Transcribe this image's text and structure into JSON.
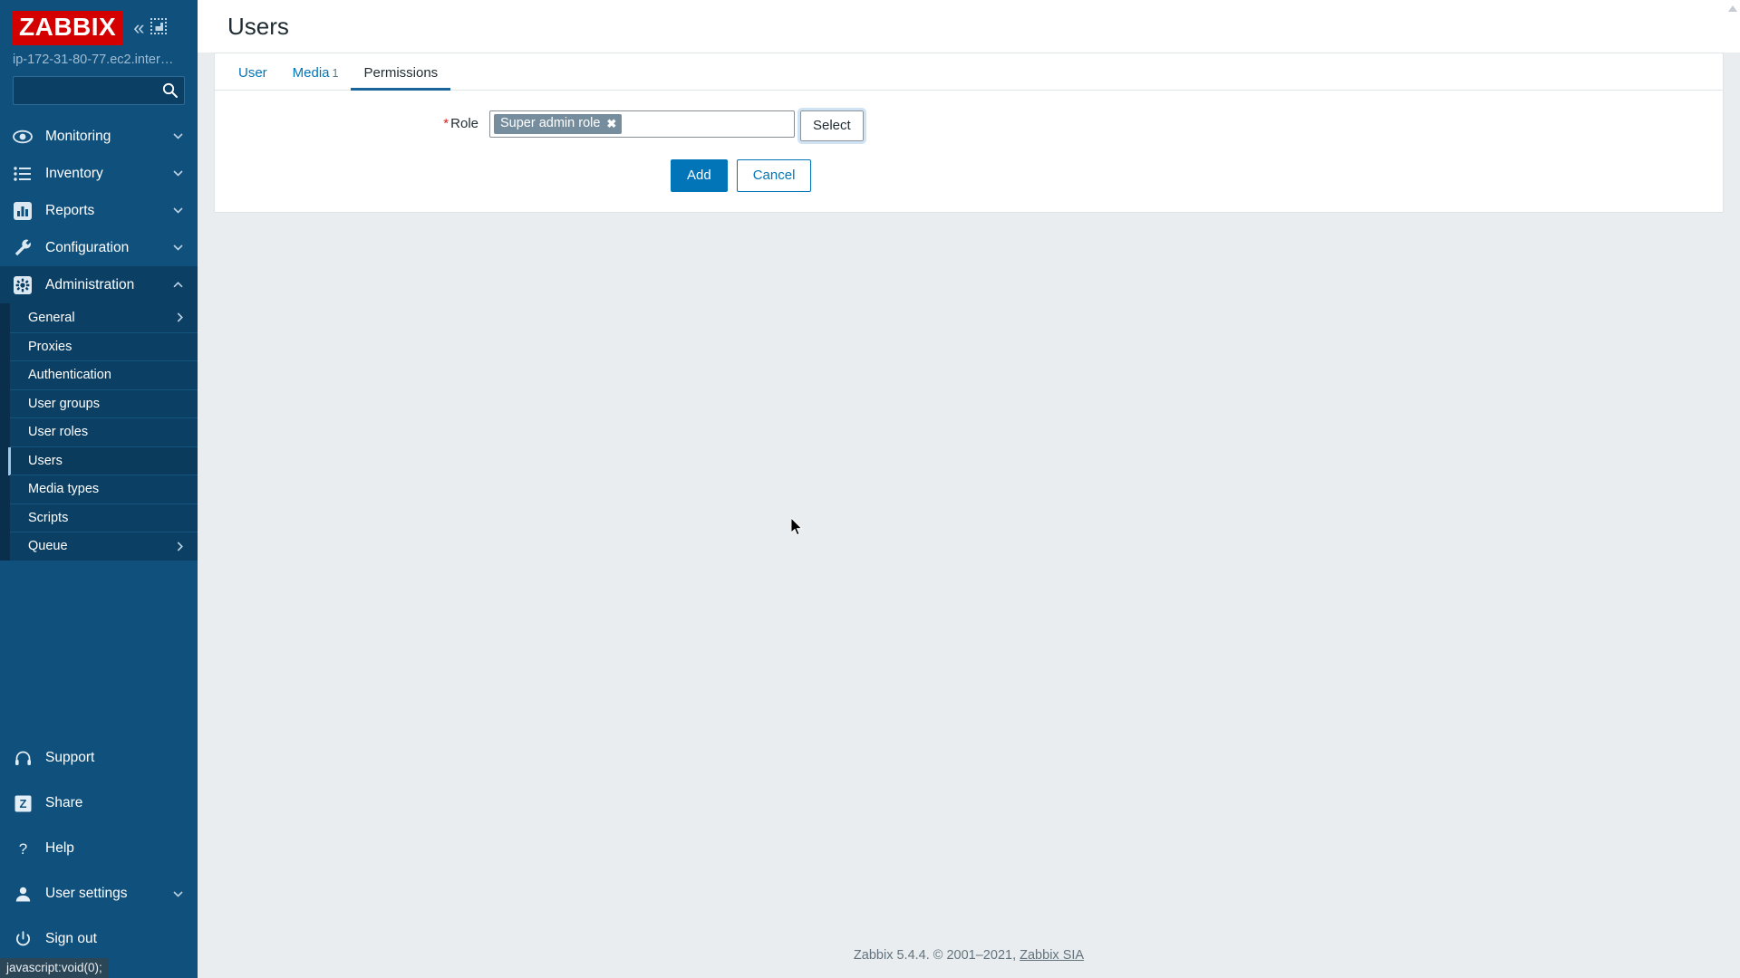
{
  "sidebar": {
    "logo_text": "ZABBIX",
    "collapse_icon": "double-chevron-left-icon",
    "compact_icon": "compact-view-icon",
    "host_name": "ip-172-31-80-77.ec2.inter…",
    "search": {
      "value": "",
      "placeholder": "",
      "icon": "search-icon"
    },
    "nav": [
      {
        "label": "Monitoring",
        "icon": "eye-icon",
        "expanded": false,
        "chevron": "chevron-down-icon"
      },
      {
        "label": "Inventory",
        "icon": "list-icon",
        "expanded": false,
        "chevron": "chevron-down-icon"
      },
      {
        "label": "Reports",
        "icon": "bar-chart-icon",
        "expanded": false,
        "chevron": "chevron-down-icon"
      },
      {
        "label": "Configuration",
        "icon": "wrench-icon",
        "expanded": false,
        "chevron": "chevron-down-icon"
      },
      {
        "label": "Administration",
        "icon": "gear-icon",
        "expanded": true,
        "chevron": "chevron-up-icon"
      }
    ],
    "submenu": [
      {
        "label": "General",
        "selected": false,
        "chevron": "chevron-right-icon"
      },
      {
        "label": "Proxies",
        "selected": false,
        "chevron": ""
      },
      {
        "label": "Authentication",
        "selected": false,
        "chevron": ""
      },
      {
        "label": "User groups",
        "selected": false,
        "chevron": ""
      },
      {
        "label": "User roles",
        "selected": false,
        "chevron": ""
      },
      {
        "label": "Users",
        "selected": true,
        "chevron": ""
      },
      {
        "label": "Media types",
        "selected": false,
        "chevron": ""
      },
      {
        "label": "Scripts",
        "selected": false,
        "chevron": ""
      },
      {
        "label": "Queue",
        "selected": false,
        "chevron": "chevron-right-icon"
      }
    ],
    "bottom": [
      {
        "label": "Support",
        "icon": "headset-icon",
        "chevron": ""
      },
      {
        "label": "Share",
        "icon": "zabbix-share-icon",
        "chevron": ""
      },
      {
        "label": "Help",
        "icon": "question-mark-icon",
        "chevron": ""
      },
      {
        "label": "User settings",
        "icon": "user-icon",
        "chevron": "chevron-down-icon"
      },
      {
        "label": "Sign out",
        "icon": "power-icon",
        "chevron": ""
      }
    ]
  },
  "statusbar": {
    "text": "javascript:void(0);"
  },
  "header": {
    "title": "Users"
  },
  "tabs": [
    {
      "label": "User",
      "count": "",
      "active": false
    },
    {
      "label": "Media",
      "count": "1",
      "active": false
    },
    {
      "label": "Permissions",
      "count": "",
      "active": true
    }
  ],
  "form": {
    "role": {
      "label": "Role",
      "required_marker": "*",
      "chip_value": "Super admin role",
      "chip_remove_icon": "close-x-icon",
      "input_value": "",
      "input_placeholder": "",
      "select_button": "Select"
    },
    "actions": {
      "submit": "Add",
      "cancel": "Cancel"
    }
  },
  "footer": {
    "text": "Zabbix 5.4.4. © 2001–2021, ",
    "link": "Zabbix SIA"
  },
  "colors": {
    "sidebar_bg": "#10507d",
    "sidebar_expanded_bg": "#0c3f64",
    "accent_blue": "#0275b8",
    "logo_red": "#d40000",
    "chip_bg": "#768d9e",
    "required_red": "#d31f1f",
    "active_tab_underline": "#18649b"
  }
}
